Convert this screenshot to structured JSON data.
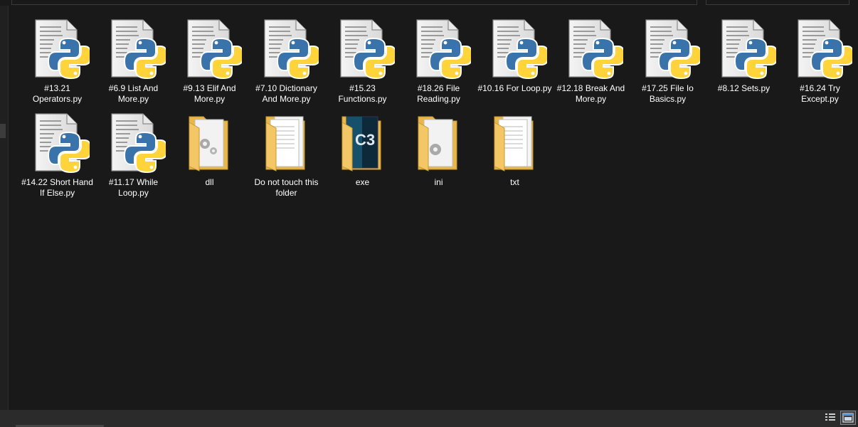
{
  "files": [
    {
      "label": "#13.21 Operators.py",
      "type": "python",
      "icon": "python-file-icon"
    },
    {
      "label": "#6.9 List And More.py",
      "type": "python",
      "icon": "python-file-icon"
    },
    {
      "label": "#9.13 Elif And More.py",
      "type": "python",
      "icon": "python-file-icon"
    },
    {
      "label": "#7.10 Dictionary And More.py",
      "type": "python",
      "icon": "python-file-icon"
    },
    {
      "label": "#15.23 Functions.py",
      "type": "python",
      "icon": "python-file-icon"
    },
    {
      "label": "#18.26 File Reading.py",
      "type": "python",
      "icon": "python-file-icon"
    },
    {
      "label": "#10.16 For Loop.py",
      "type": "python",
      "icon": "python-file-icon"
    },
    {
      "label": "#12.18 Break And More.py",
      "type": "python",
      "icon": "python-file-icon"
    },
    {
      "label": "#17.25 File Io Basics.py",
      "type": "python",
      "icon": "python-file-icon"
    },
    {
      "label": "#8.12 Sets.py",
      "type": "python",
      "icon": "python-file-icon"
    },
    {
      "label": "#16.24 Try Except.py",
      "type": "python",
      "icon": "python-file-icon"
    },
    {
      "label": "#14.22 Short Hand If Else.py",
      "type": "python",
      "icon": "python-file-icon"
    },
    {
      "label": "#11.17 While Loop.py",
      "type": "python",
      "icon": "python-file-icon"
    },
    {
      "label": "dll",
      "type": "folder-gears",
      "icon": "folder-gears-icon"
    },
    {
      "label": "Do not touch this folder",
      "type": "folder-docs",
      "icon": "folder-documents-icon"
    },
    {
      "label": "exe",
      "type": "folder-c3",
      "icon": "folder-c3-icon"
    },
    {
      "label": "ini",
      "type": "folder-gear",
      "icon": "folder-gear-icon"
    },
    {
      "label": "txt",
      "type": "folder-docs",
      "icon": "folder-documents-icon"
    }
  ],
  "colors": {
    "background": "#191919",
    "text": "#ffffff",
    "python_blue": "#3a73a9",
    "python_yellow": "#ffd43b",
    "folder_yellow": "#f3c766"
  },
  "view_modes": {
    "details_icon": "details-view-icon",
    "large_icons_icon": "large-icons-view-icon",
    "active": "large-icons"
  }
}
